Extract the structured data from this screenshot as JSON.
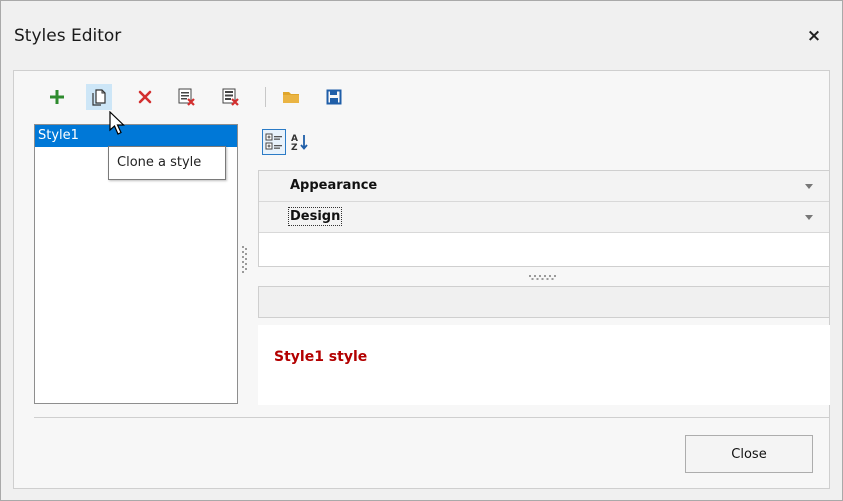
{
  "window": {
    "title": "Styles Editor",
    "close_glyph": "×"
  },
  "toolbar": {
    "buttons": [
      {
        "name": "add-style-button",
        "icon": "plus-icon",
        "color": "#2e8b2e"
      },
      {
        "name": "clone-style-button",
        "icon": "copy-page-icon",
        "hovered": true
      },
      {
        "name": "delete-style-button",
        "icon": "red-x-icon",
        "color": "#d32f2f"
      },
      {
        "name": "purge-styles-button",
        "icon": "list-delete-icon"
      },
      {
        "name": "clear-styles-button",
        "icon": "list-clear-icon"
      },
      {
        "name": "open-file-button",
        "icon": "folder-icon",
        "color": "#e0a62b"
      },
      {
        "name": "save-file-button",
        "icon": "floppy-disk-icon",
        "color": "#1f5ea8"
      }
    ],
    "tooltip": "Clone a style"
  },
  "style_list": {
    "items": [
      {
        "label": "Style1",
        "selected": true
      }
    ]
  },
  "property_grid": {
    "toolbar": [
      {
        "name": "categorized-view-button",
        "icon": "categorized-icon",
        "active": true
      },
      {
        "name": "alphabetical-sort-button",
        "icon": "sort-az-icon",
        "active": false
      }
    ],
    "categories": [
      {
        "label": "Appearance",
        "focused": false
      },
      {
        "label": "Design",
        "focused": true
      }
    ],
    "description": ""
  },
  "preview": {
    "text": "Style1 style",
    "color": "#b30000"
  },
  "footer": {
    "close_label": "Close"
  }
}
